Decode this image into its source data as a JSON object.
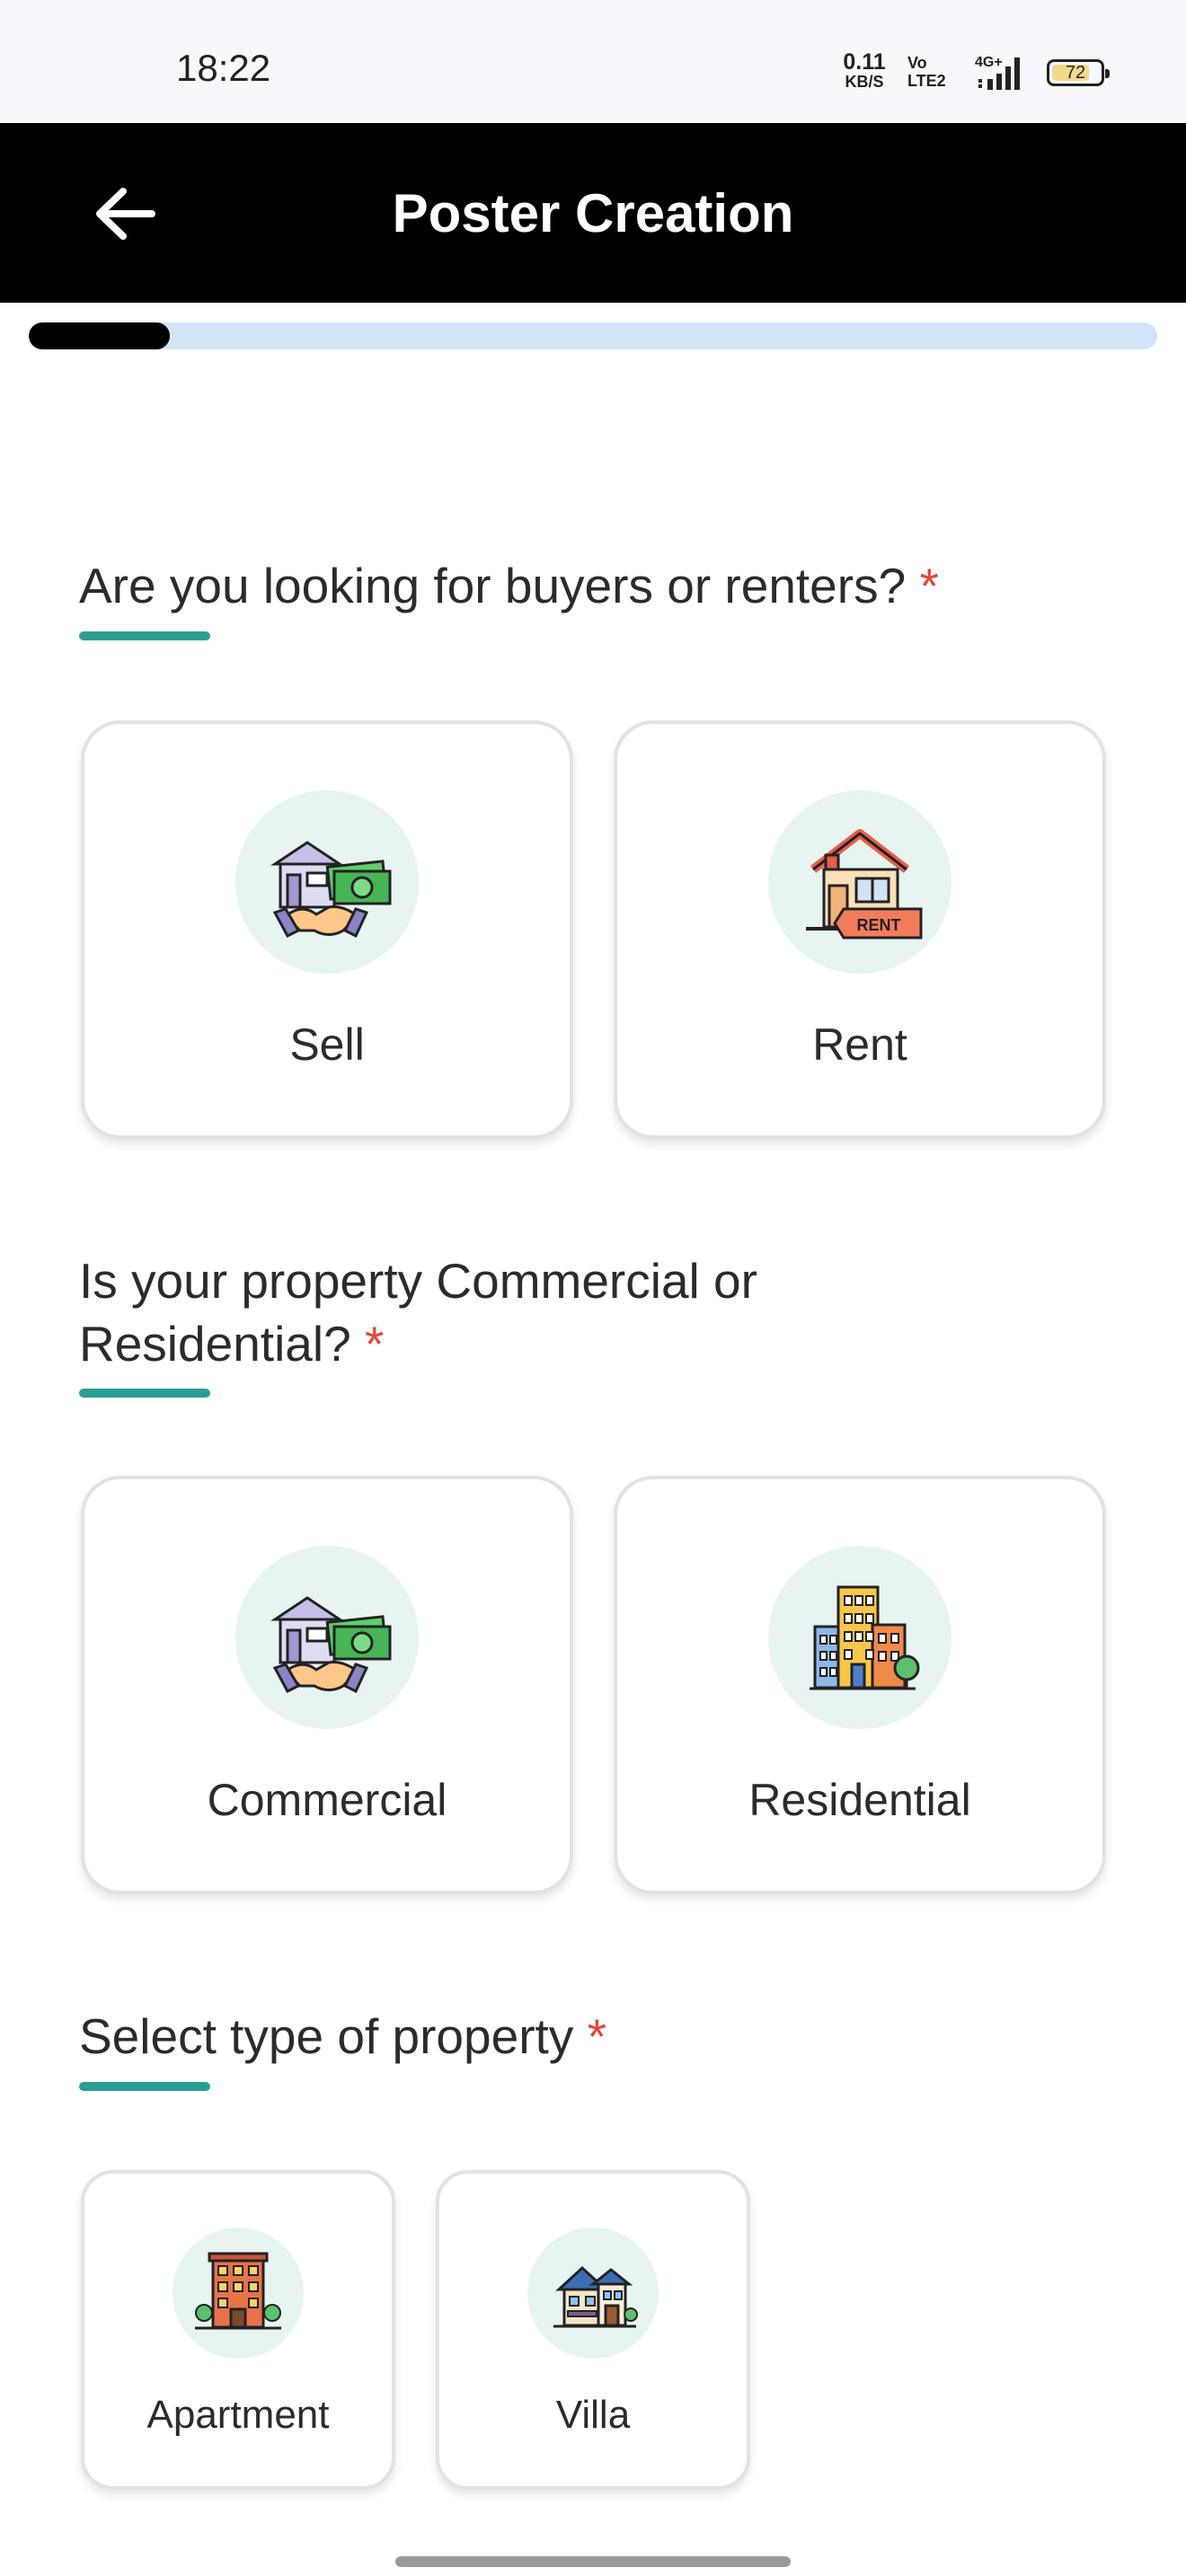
{
  "status_bar": {
    "time": "18:22",
    "net_speed_value": "0.11",
    "net_speed_unit": "KB/S",
    "volte_top": "Vo",
    "volte_bottom": "LTE2",
    "network": "4G+",
    "battery": "72"
  },
  "header": {
    "title": "Poster Creation",
    "back_icon": "arrow-left-icon"
  },
  "progress": {
    "fraction": 0.125
  },
  "colors": {
    "accent": "#2a9e94",
    "required": "#e0483a",
    "icon_circle_bg": "#e7f4f1",
    "progress_track": "#d3e4fa",
    "header_bg": "#000000"
  },
  "sections": [
    {
      "title": "Are you looking for buyers or renters?",
      "required_mark": "*",
      "options": [
        {
          "label": "Sell",
          "icon": "house-handshake-money-icon"
        },
        {
          "label": "Rent",
          "icon": "house-rent-sign-icon"
        }
      ]
    },
    {
      "title_line1": "Is your property Commercial or",
      "title_line2": "Residential?",
      "required_mark": "*",
      "options": [
        {
          "label": "Commercial",
          "icon": "house-handshake-money-icon"
        },
        {
          "label": "Residential",
          "icon": "city-buildings-icon"
        }
      ]
    },
    {
      "title": "Select type of property",
      "required_mark": "*",
      "options": [
        {
          "label": "Apartment",
          "icon": "apartment-building-icon"
        },
        {
          "label": "Villa",
          "icon": "villa-house-icon"
        }
      ]
    }
  ]
}
